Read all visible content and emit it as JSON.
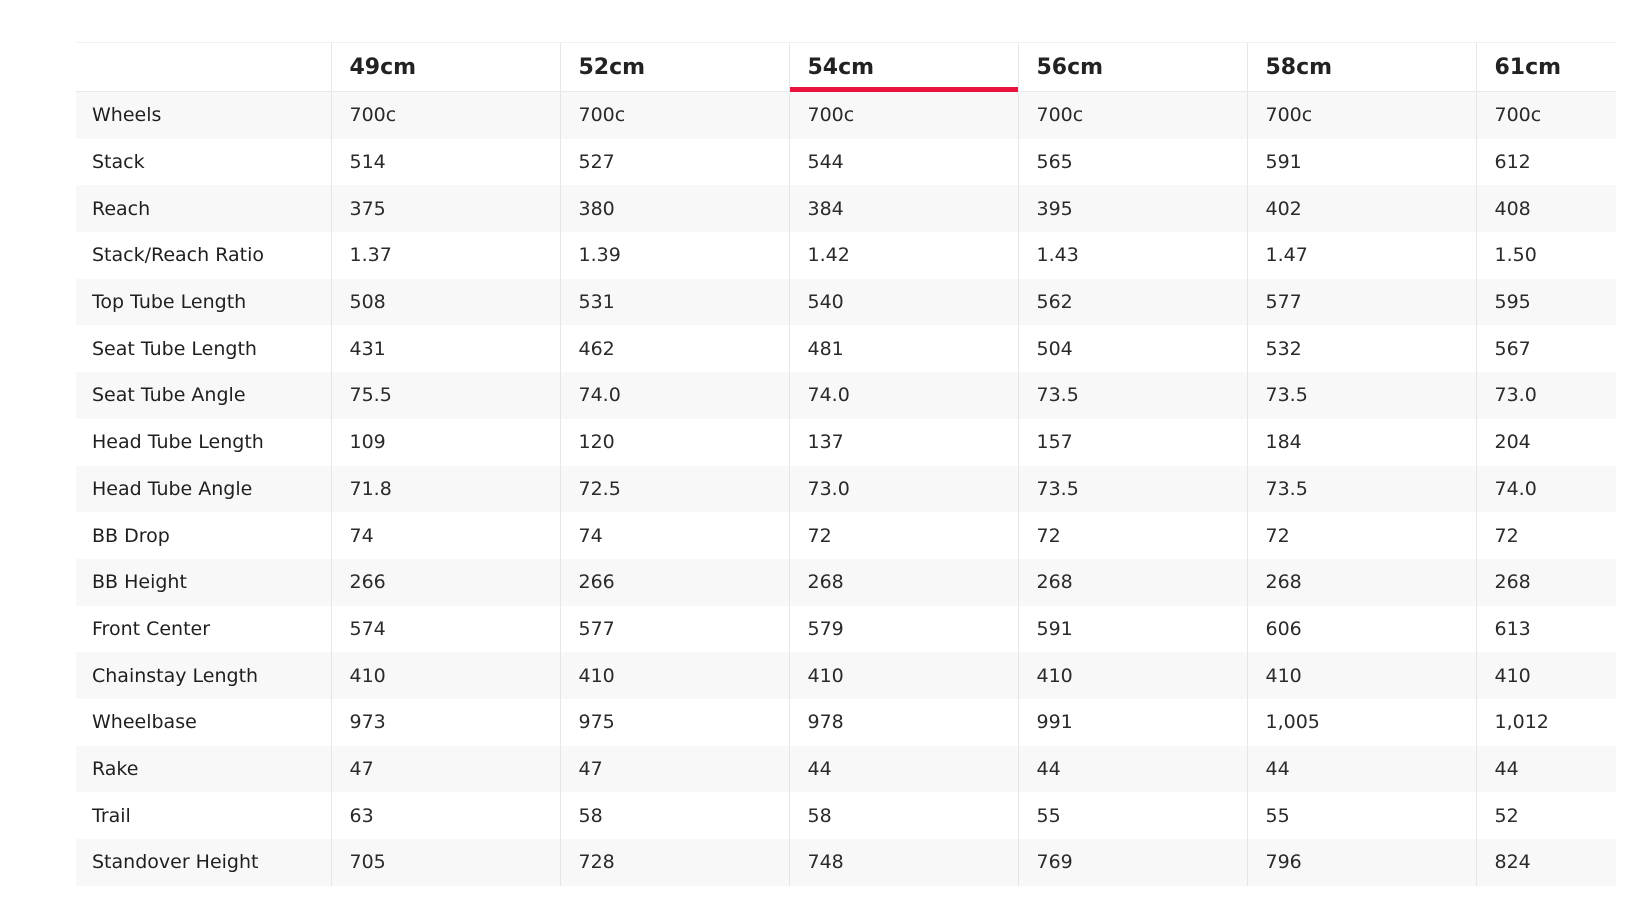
{
  "geometry_table": {
    "sizes": [
      "49cm",
      "52cm",
      "54cm",
      "56cm",
      "58cm",
      "61cm"
    ],
    "selected_size": "54cm",
    "accent_color": "#e8123c",
    "rows": [
      {
        "label": "Wheels",
        "values": [
          "700c",
          "700c",
          "700c",
          "700c",
          "700c",
          "700c"
        ]
      },
      {
        "label": "Stack",
        "values": [
          "514",
          "527",
          "544",
          "565",
          "591",
          "612"
        ]
      },
      {
        "label": "Reach",
        "values": [
          "375",
          "380",
          "384",
          "395",
          "402",
          "408"
        ]
      },
      {
        "label": "Stack/Reach Ratio",
        "values": [
          "1.37",
          "1.39",
          "1.42",
          "1.43",
          "1.47",
          "1.50"
        ]
      },
      {
        "label": "Top Tube Length",
        "values": [
          "508",
          "531",
          "540",
          "562",
          "577",
          "595"
        ]
      },
      {
        "label": "Seat Tube Length",
        "values": [
          "431",
          "462",
          "481",
          "504",
          "532",
          "567"
        ]
      },
      {
        "label": "Seat Tube Angle",
        "values": [
          "75.5",
          "74.0",
          "74.0",
          "73.5",
          "73.5",
          "73.0"
        ]
      },
      {
        "label": "Head Tube Length",
        "values": [
          "109",
          "120",
          "137",
          "157",
          "184",
          "204"
        ]
      },
      {
        "label": "Head Tube Angle",
        "values": [
          "71.8",
          "72.5",
          "73.0",
          "73.5",
          "73.5",
          "74.0"
        ]
      },
      {
        "label": "BB Drop",
        "values": [
          "74",
          "74",
          "72",
          "72",
          "72",
          "72"
        ]
      },
      {
        "label": "BB Height",
        "values": [
          "266",
          "266",
          "268",
          "268",
          "268",
          "268"
        ]
      },
      {
        "label": "Front Center",
        "values": [
          "574",
          "577",
          "579",
          "591",
          "606",
          "613"
        ]
      },
      {
        "label": "Chainstay Length",
        "values": [
          "410",
          "410",
          "410",
          "410",
          "410",
          "410"
        ]
      },
      {
        "label": "Wheelbase",
        "values": [
          "973",
          "975",
          "978",
          "991",
          "1,005",
          "1,012"
        ]
      },
      {
        "label": "Rake",
        "values": [
          "47",
          "47",
          "44",
          "44",
          "44",
          "44"
        ]
      },
      {
        "label": "Trail",
        "values": [
          "63",
          "58",
          "58",
          "55",
          "55",
          "52"
        ]
      },
      {
        "label": "Standover Height",
        "values": [
          "705",
          "728",
          "748",
          "769",
          "796",
          "824"
        ]
      }
    ]
  }
}
